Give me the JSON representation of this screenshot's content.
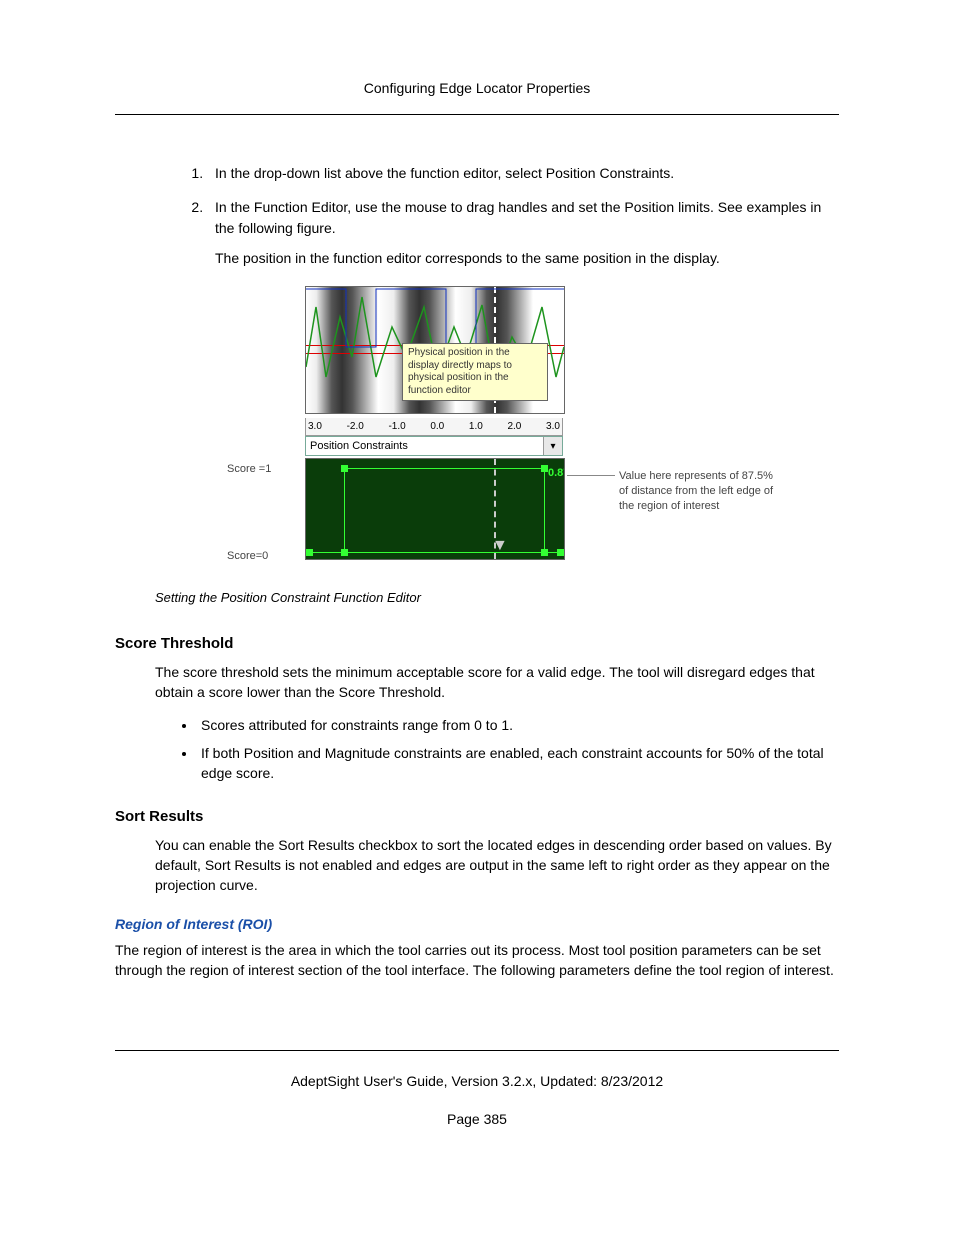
{
  "header": {
    "title": "Configuring Edge Locator Properties"
  },
  "steps": {
    "s1": "In the drop-down list above the function editor, select Position Constraints.",
    "s2": "In the Function Editor, use the mouse to drag handles and set the Position limits. See examples in the following figure.",
    "s2b": "The position in the function editor corresponds to the same position in the display."
  },
  "figure": {
    "tooltip": "Physical position in the display directly maps to physical position in the function editor",
    "axis": {
      "t0": "3.0",
      "t1": "-2.0",
      "t2": "-1.0",
      "t3": "0.0",
      "t4": "1.0",
      "t5": "2.0",
      "t6": "3.0"
    },
    "dropdown_label": "Position Constraints",
    "score1": "Score =1",
    "score0": "Score=0",
    "value": "0.875",
    "annot": "Value here represents of 87.5% of distance from the left edge of the region of interest",
    "caption": "Setting the Position Constraint Function Editor"
  },
  "score_threshold": {
    "heading": "Score Threshold",
    "p1": "The score threshold sets the minimum acceptable score for a valid edge. The tool will disregard edges that obtain a score lower than the Score Threshold.",
    "b1": "Scores attributed for constraints range from 0 to 1.",
    "b2": "If both Position and Magnitude constraints are enabled, each constraint accounts for 50% of the total edge score."
  },
  "sort_results": {
    "heading": "Sort Results",
    "p1": "You can enable the Sort Results checkbox to sort the located edges in descending order based on values. By default, Sort Results is not enabled and edges are output in the same left to right order as they appear on the projection curve."
  },
  "roi": {
    "heading": "Region of Interest (ROI)",
    "p1": "The region of interest is the area in which the tool carries out its process. Most tool position parameters can be set through the region of interest section of the tool interface. The following parameters define the tool region of interest."
  },
  "footer": {
    "line": "AdeptSight User's Guide,  Version 3.2.x, Updated: 8/23/2012",
    "page": "Page 385"
  }
}
